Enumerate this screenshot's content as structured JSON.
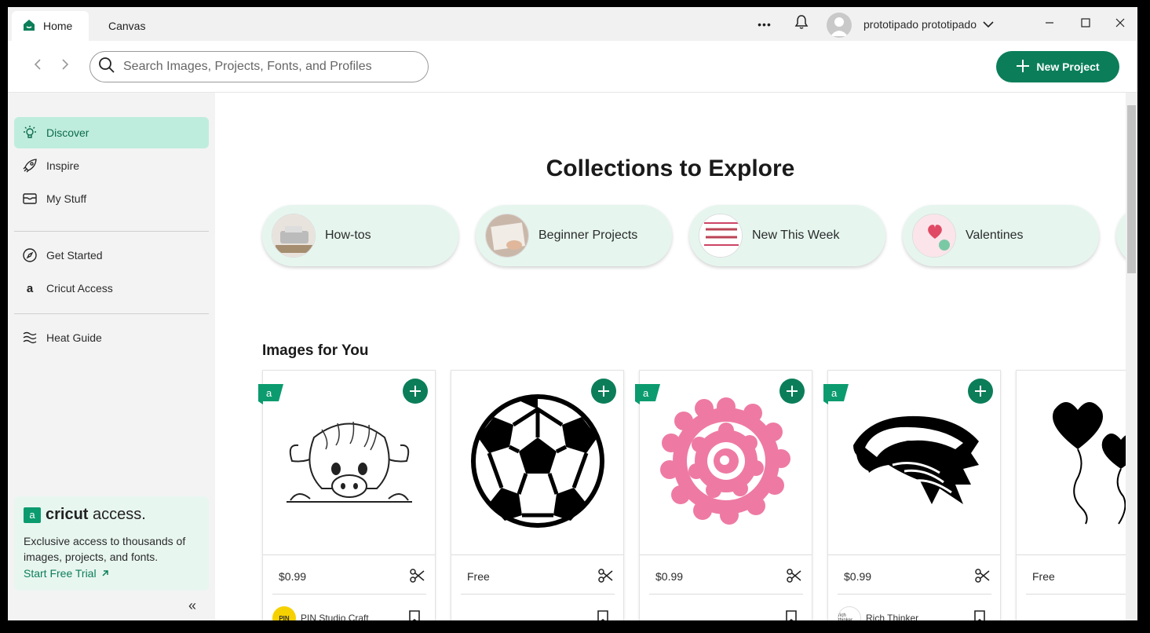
{
  "tabs": {
    "home": "Home",
    "canvas": "Canvas"
  },
  "titlebar": {
    "more": "•••",
    "username": "prototipado prototipado"
  },
  "search": {
    "placeholder": "Search Images, Projects, Fonts, and Profiles"
  },
  "toolbar": {
    "new_project": "New Project"
  },
  "sidebar": {
    "items": [
      {
        "label": "Discover",
        "icon": "lightbulb-icon",
        "active": true
      },
      {
        "label": "Inspire",
        "icon": "rocket-icon"
      },
      {
        "label": "My Stuff",
        "icon": "inbox-icon"
      },
      {
        "label": "Get Started",
        "icon": "compass-icon"
      },
      {
        "label": "Cricut Access",
        "icon": "access-a-icon"
      },
      {
        "label": "Heat Guide",
        "icon": "heat-waves-icon"
      }
    ],
    "promo": {
      "brand": "cricut",
      "brand_suffix": "access.",
      "text": "Exclusive access to thousands of images, projects, and fonts.",
      "link": "Start Free Trial"
    },
    "collapse": "«"
  },
  "main": {
    "collections_title": "Collections to Explore",
    "collections": [
      {
        "label": "How-tos"
      },
      {
        "label": "Beginner Projects"
      },
      {
        "label": "New This Week"
      },
      {
        "label": "Valentines"
      }
    ],
    "images_title": "Images for You",
    "cards": [
      {
        "price": "$0.99",
        "author": "PIN Studio Craft",
        "access": true,
        "image": "highland-cow-icon"
      },
      {
        "price": "Free",
        "author": "",
        "access": false,
        "image": "soccer-ball-icon"
      },
      {
        "price": "$0.99",
        "author": "",
        "access": true,
        "image": "rolled-flower-icon"
      },
      {
        "price": "$0.99",
        "author": "Rich Thinker",
        "access": true,
        "image": "eagle-head-icon"
      },
      {
        "price": "Free",
        "author": "",
        "access": false,
        "image": "heart-balloons-icon"
      }
    ]
  },
  "colors": {
    "brand_green": "#0b7e59",
    "active_bg": "#bfeddd",
    "pill_bg": "#e6f6ef"
  }
}
